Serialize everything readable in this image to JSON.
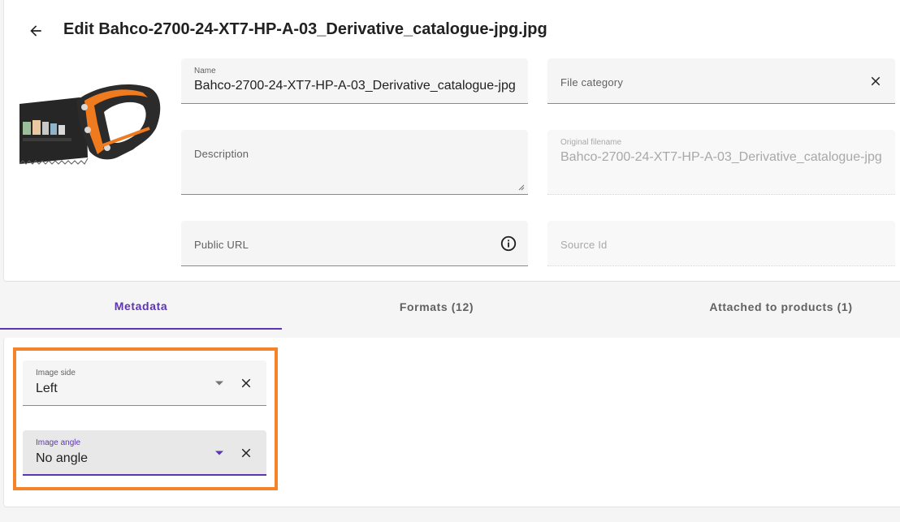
{
  "header": {
    "title": "Edit Bahco-2700-24-XT7-HP-A-03_Derivative_catalogue-jpg.jpg",
    "back_icon": "arrow-left-icon"
  },
  "form": {
    "name": {
      "label": "Name",
      "value": "Bahco-2700-24-XT7-HP-A-03_Derivative_catalogue-jpg.jpg"
    },
    "file_category": {
      "placeholder": "File category",
      "clear_icon": "close-icon"
    },
    "description": {
      "placeholder": "Description"
    },
    "original_filename": {
      "label": "Original filename",
      "value": "Bahco-2700-24-XT7-HP-A-03_Derivative_catalogue-jpg.jpg"
    },
    "public_url": {
      "placeholder": "Public URL",
      "info_icon": "info-icon"
    },
    "source_id": {
      "placeholder": "Source Id"
    }
  },
  "tabs": [
    {
      "label": "Metadata",
      "active": true
    },
    {
      "label": "Formats (12)",
      "active": false
    },
    {
      "label": "Attached to products (1)",
      "active": false
    }
  ],
  "metadata": {
    "image_side": {
      "label": "Image side",
      "value": "Left"
    },
    "image_angle": {
      "label": "Image angle",
      "value": "No angle"
    }
  },
  "colors": {
    "accent": "#5e35b1",
    "highlight": "#f5832a",
    "saw_handle_orange": "#f07a1e",
    "saw_handle_black": "#2b2b2b"
  }
}
